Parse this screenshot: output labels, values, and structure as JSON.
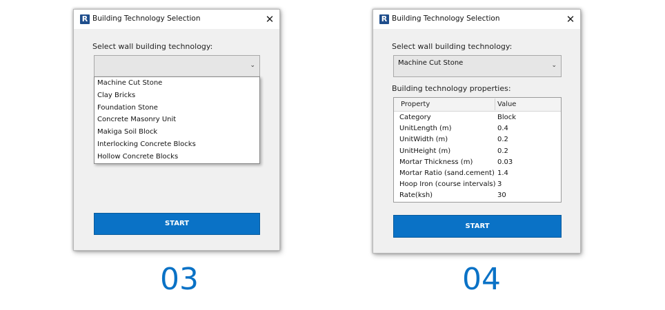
{
  "screens": [
    {
      "window_title": "Building Technology Selection",
      "app_icon_letter": "R",
      "close_glyph": "✕",
      "select_label": "Select wall building technology:",
      "combo_value": "",
      "chevron": "⌄",
      "dropdown_options": [
        "Machine Cut Stone",
        "Clay Bricks",
        "Foundation Stone",
        "Concrete Masonry Unit",
        "Makiga Soil Block",
        "Interlocking Concrete Blocks",
        "Hollow Concrete Blocks"
      ],
      "start_label": "START",
      "step_label": "03"
    },
    {
      "window_title": "Building Technology Selection",
      "app_icon_letter": "R",
      "close_glyph": "✕",
      "select_label": "Select wall building technology:",
      "combo_value": "Machine Cut Stone",
      "chevron": "⌄",
      "properties_label": "Building technology properties:",
      "properties": {
        "headers": [
          "Property",
          "Value"
        ],
        "rows": [
          [
            "Category",
            "Block"
          ],
          [
            "UnitLength (m)",
            "0.4"
          ],
          [
            "UnitWidth (m)",
            "0.2"
          ],
          [
            "UnitHeight (m)",
            "0.2"
          ],
          [
            "Mortar Thickness (m)",
            "0.03"
          ],
          [
            "Mortar Ratio (sand.cement)",
            "1.4"
          ],
          [
            "Hoop Iron (course intervals)",
            "3"
          ],
          [
            "Rate(ksh)",
            "30"
          ]
        ]
      },
      "start_label": "START",
      "step_label": "04"
    }
  ],
  "colors": {
    "accent": "#0a72c6",
    "window_bg": "#f0f0f0",
    "icon_bg": "#1f4e8c"
  },
  "icons": {
    "app": "revit-r-icon",
    "close": "close-icon",
    "dropdown": "chevron-down-icon"
  }
}
